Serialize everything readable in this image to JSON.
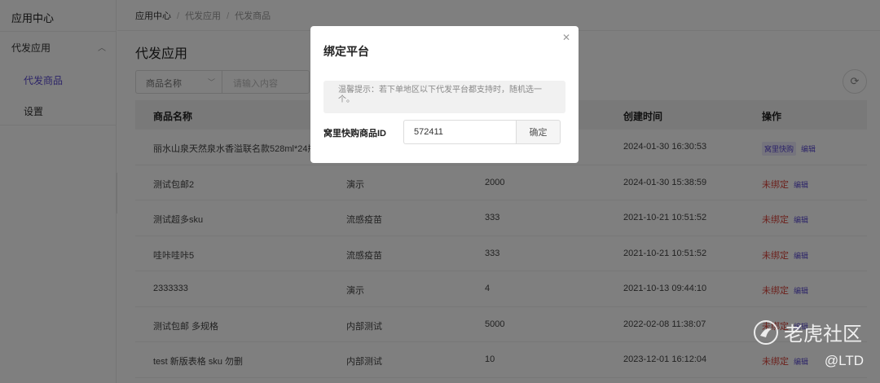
{
  "sidebar": {
    "title": "应用中心",
    "group_label": "代发应用",
    "items": [
      {
        "label": "代发商品",
        "active": true
      },
      {
        "label": "设置",
        "active": false
      }
    ]
  },
  "breadcrumb": [
    "应用中心",
    "代发应用",
    "代发商品"
  ],
  "page_title": "代发应用",
  "filter": {
    "select_value": "商品名称",
    "input_placeholder": "请输入内容"
  },
  "table": {
    "columns": [
      "商品名称",
      "",
      "",
      "创建时间",
      "操作"
    ],
    "rows": [
      {
        "name": "丽水山泉天然泉水香溢联名款528ml*24瓶",
        "type": "",
        "price": "",
        "created": "2024-01-30 16:30:53",
        "status": "窝里快购",
        "bound": true,
        "action": "编辑"
      },
      {
        "name": "测试包邮2",
        "type": "演示",
        "price": "2000",
        "created": "2024-01-30 15:38:59",
        "status": "未绑定",
        "bound": false,
        "action": "编辑"
      },
      {
        "name": "测试超多sku",
        "type": "流感疫苗",
        "price": "333",
        "created": "2021-10-21 10:51:52",
        "status": "未绑定",
        "bound": false,
        "action": "编辑"
      },
      {
        "name": "哇咔哇咔5",
        "type": "流感疫苗",
        "price": "333",
        "created": "2021-10-21 10:51:52",
        "status": "未绑定",
        "bound": false,
        "action": "编辑"
      },
      {
        "name": "2333333",
        "type": "演示",
        "price": "4",
        "created": "2021-10-13 09:44:10",
        "status": "未绑定",
        "bound": false,
        "action": "编辑"
      },
      {
        "name": "测试包邮 多规格",
        "type": "内部测试",
        "price": "5000",
        "created": "2022-02-08 11:38:07",
        "status": "未绑定",
        "bound": false,
        "action": "编辑"
      },
      {
        "name": "test 新版表格 sku 勿删",
        "type": "内部测试",
        "price": "10",
        "created": "2023-12-01 16:12:04",
        "status": "未绑定",
        "bound": false,
        "action": "编辑"
      }
    ]
  },
  "dialog": {
    "title": "绑定平台",
    "tip": "温馨提示：若下单地区以下代发平台都支持时，随机选一个。",
    "field_label": "窝里快购商品ID",
    "field_value": "572411",
    "confirm_label": "确定"
  },
  "watermark": {
    "brand": "老虎社区",
    "handle": "@LTD"
  },
  "colors": {
    "accent": "#5a4ad1",
    "danger": "#d9443b",
    "overlay": "rgba(0,0,0,0.5)"
  }
}
